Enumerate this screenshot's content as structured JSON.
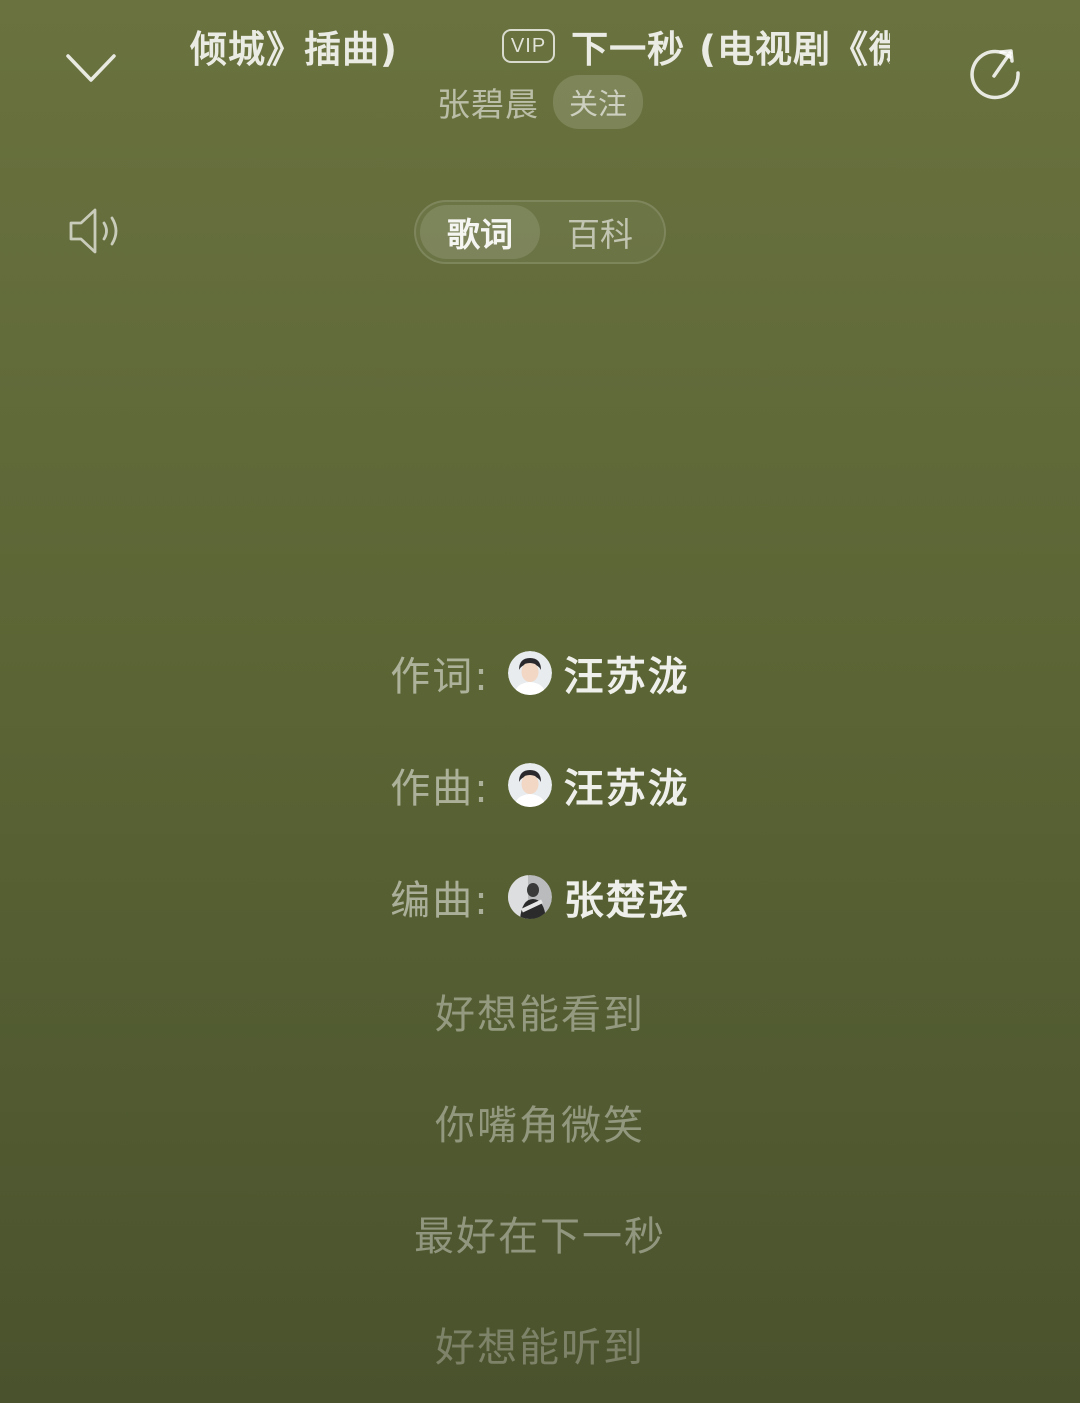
{
  "header": {
    "title_tail": "倾城》插曲)",
    "vip_badge": "VIP",
    "title_head": "下一秒 (电视剧《微",
    "artist": "张碧晨",
    "follow_label": "关注"
  },
  "icons": {
    "collapse": "chevron-down-icon",
    "share": "share-icon",
    "volume": "volume-icon"
  },
  "tabs": [
    {
      "label": "歌词",
      "active": true
    },
    {
      "label": "百科",
      "active": false
    }
  ],
  "credits": [
    {
      "role": "作词:",
      "name": "汪苏泷",
      "avatar": "avatar-light"
    },
    {
      "role": "作曲:",
      "name": "汪苏泷",
      "avatar": "avatar-light"
    },
    {
      "role": "编曲:",
      "name": "张楚弦",
      "avatar": "avatar-dark"
    }
  ],
  "lyrics": [
    "好想能看到",
    "你嘴角微笑",
    "最好在下一秒",
    "好想能听到"
  ],
  "colors": {
    "background_top": "#6a733f",
    "background_bottom": "#4a522d"
  }
}
